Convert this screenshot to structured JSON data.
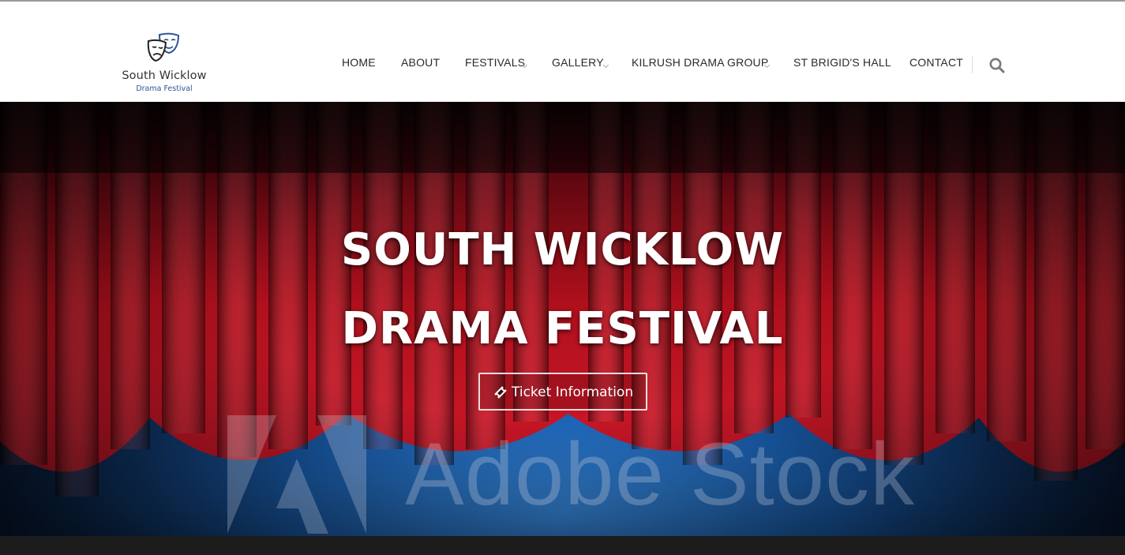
{
  "brand": {
    "title": "South Wicklow",
    "subtitle": "Drama Festival"
  },
  "nav": {
    "items": [
      {
        "label": "HOME"
      },
      {
        "label": "ABOUT"
      },
      {
        "label": "FESTIVALS"
      },
      {
        "label": "GALLERY"
      },
      {
        "label": "KILRUSH DRAMA GROUP"
      },
      {
        "label": "ST BRIGID'S HALL"
      },
      {
        "label": "CONTACT"
      }
    ],
    "search_icon": "search-icon"
  },
  "hero": {
    "title_line1": "SOUTH WICKLOW",
    "title_line2": "DRAMA FESTIVAL",
    "button_label": "Ticket Information",
    "button_icon": "ticket-icon",
    "watermark_text": "Adobe Stock"
  },
  "colors": {
    "curtain_red": "#b0101c",
    "stage_blue": "#1a5fb0",
    "nav_text": "#2a2a2a",
    "logo_subtitle": "#2e5597"
  }
}
